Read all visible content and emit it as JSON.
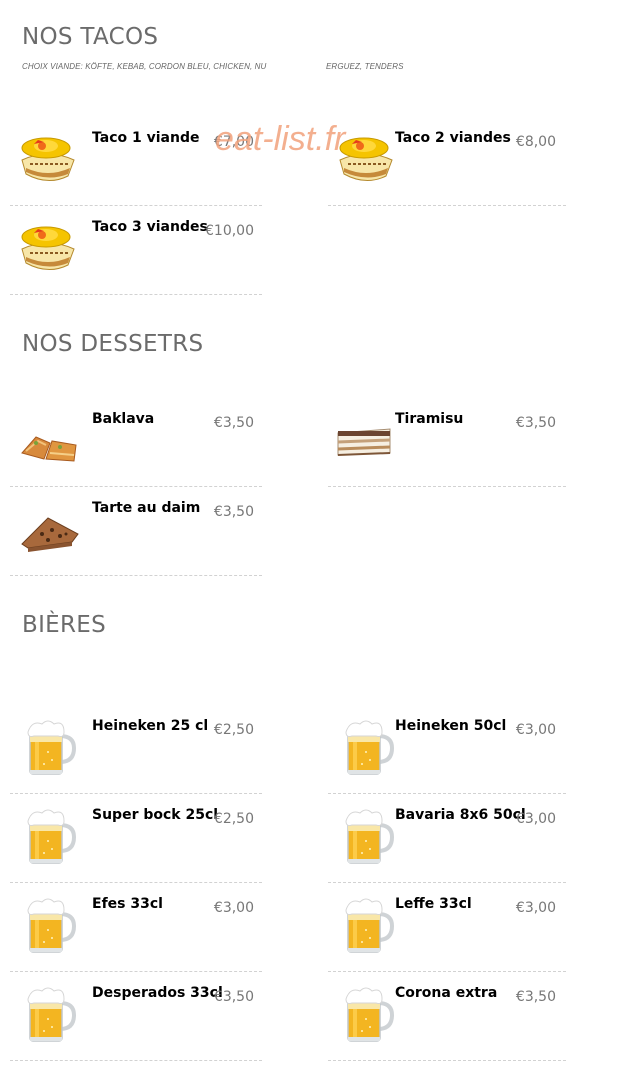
{
  "sections": {
    "tacos": {
      "title": "NOS TACOS",
      "subtitle": "CHOIX VIANDE: KÖFTE, KEBAB, CORDON BLEU, CHICKEN, NU",
      "subtitle_tail": "ERGUEZ, TENDERS",
      "items": [
        {
          "name": "Taco 1 viande",
          "price": "€7,00",
          "image": "taco-image"
        },
        {
          "name": "Taco 2 viandes",
          "price": "€8,00",
          "image": "taco-image"
        },
        {
          "name": "Taco 3 viandes",
          "price": "€10,00",
          "image": "taco-image"
        }
      ]
    },
    "desserts": {
      "title": "NOS DESSETRS",
      "items": [
        {
          "name": "Baklava",
          "price": "€3,50",
          "image": "baklava-image"
        },
        {
          "name": "Tiramisu",
          "price": "€3,50",
          "image": "tiramisu-image"
        },
        {
          "name": "Tarte au daim",
          "price": "€3,50",
          "image": "tart-image"
        }
      ]
    },
    "beers": {
      "title": "BIÈRES",
      "items": [
        {
          "name": "Heineken 25 cl",
          "price": "€2,50",
          "image": "beer-mug-image"
        },
        {
          "name": "Heineken 50cl",
          "price": "€3,00",
          "image": "beer-mug-image"
        },
        {
          "name": "Super bock 25cl",
          "price": "€2,50",
          "image": "beer-mug-image"
        },
        {
          "name": "Bavaria 8x6 50cl",
          "price": "€3,00",
          "image": "beer-mug-image"
        },
        {
          "name": "Efes 33cl",
          "price": "€3,00",
          "image": "beer-mug-image"
        },
        {
          "name": "Leffe 33cl",
          "price": "€3,00",
          "image": "beer-mug-image"
        },
        {
          "name": "Desperados 33cl",
          "price": "€3,50",
          "image": "beer-mug-image"
        },
        {
          "name": "Corona extra",
          "price": "€3,50",
          "image": "beer-mug-image"
        }
      ]
    }
  },
  "watermark": "eat-list.fr",
  "colors": {
    "title": "#6b6b6b",
    "price": "#777777",
    "divider": "#d2d2d2",
    "watermark": "#f2a27c"
  }
}
